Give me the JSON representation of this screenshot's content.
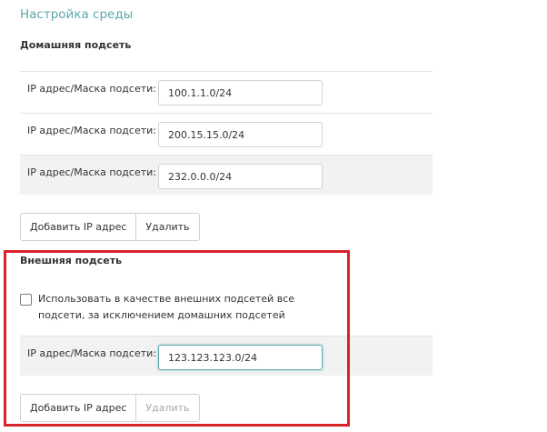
{
  "settings": {
    "title": "Настройка среды"
  },
  "home_subnet": {
    "title": "Домашняя подсеть",
    "rows": [
      {
        "label": "IP адрес/Маска подсети:",
        "value": "100.1.1.0/24"
      },
      {
        "label": "IP адрес/Маска подсети:",
        "value": "200.15.15.0/24"
      },
      {
        "label": "IP адрес/Маска подсети:",
        "value": "232.0.0.0/24"
      }
    ],
    "add_label": "Добавить IP адрес",
    "delete_label": "Удалить"
  },
  "external_subnet": {
    "title": "Внешняя подсеть",
    "checkbox_label": "Использовать в качестве внешних подсетей все подсети, за исключением домашних подсетей",
    "checkbox_checked": false,
    "rows": [
      {
        "label": "IP адрес/Маска подсети:",
        "value": "123.123.123.0/24"
      }
    ],
    "add_label": "Добавить IP адрес",
    "delete_label": "Удалить"
  },
  "colors": {
    "accent": "#5fa7a7",
    "highlight": "#d9232b"
  }
}
